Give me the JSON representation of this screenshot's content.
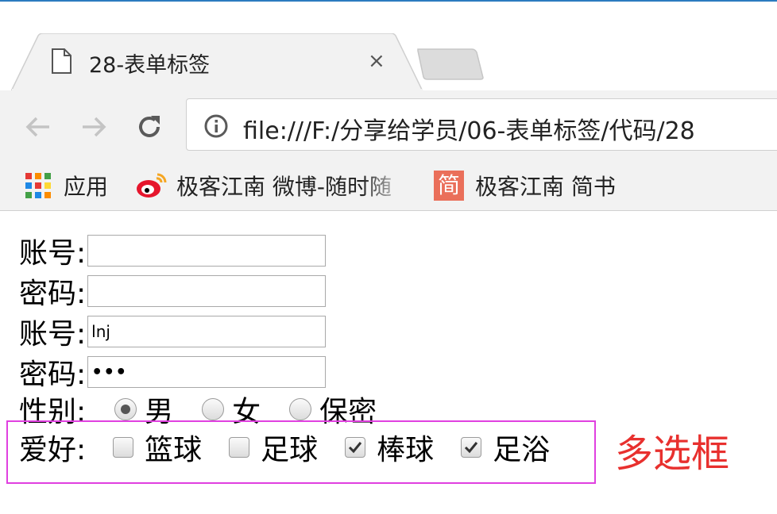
{
  "tab": {
    "title": "28-表单标签",
    "close_glyph": "×"
  },
  "address_bar": {
    "url": "file:///F:/分享给学员/06-表单标签/代码/28"
  },
  "bookmarks": [
    {
      "label": "应用",
      "icon": "apps-grid-icon"
    },
    {
      "label": "极客江南 微博-随时随",
      "icon": "weibo-icon"
    },
    {
      "label": "极客江南 简书",
      "icon": "jianshu-icon",
      "icon_text": "简"
    }
  ],
  "form": {
    "account1": {
      "label": "账号:",
      "value": ""
    },
    "password1": {
      "label": "密码:",
      "value": ""
    },
    "account2": {
      "label": "账号:",
      "value": "lnj"
    },
    "password2": {
      "label": "密码:",
      "value": "•••"
    },
    "gender": {
      "label": "性别:",
      "options": [
        {
          "label": "男",
          "checked": true
        },
        {
          "label": "女",
          "checked": false
        },
        {
          "label": "保密",
          "checked": false
        }
      ]
    },
    "hobby": {
      "label": "爱好:",
      "options": [
        {
          "label": "篮球",
          "checked": false
        },
        {
          "label": "足球",
          "checked": false
        },
        {
          "label": "棒球",
          "checked": true
        },
        {
          "label": "足浴",
          "checked": true
        }
      ]
    }
  },
  "annotation": "多选框",
  "colors": {
    "accent_line": "#2b7bbf",
    "highlight_box": "#e040e0",
    "annotation": "#e8302e"
  }
}
